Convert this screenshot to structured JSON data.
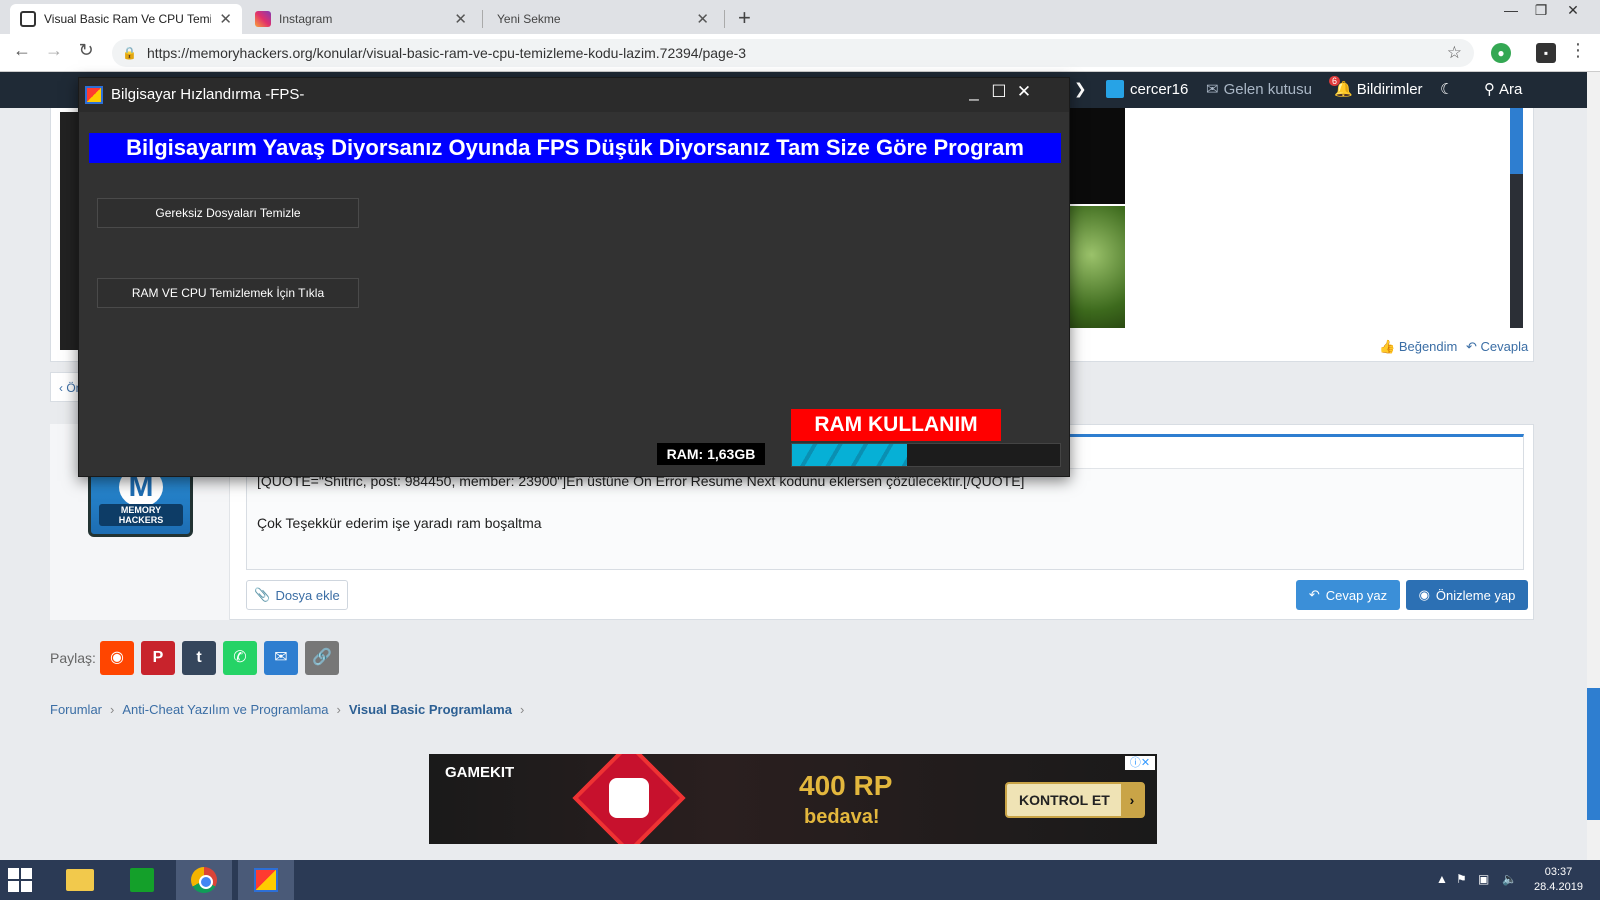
{
  "browser": {
    "tabs": [
      {
        "title": "Visual Basic Ram Ve CPU Temizle"
      },
      {
        "title": "Instagram"
      },
      {
        "title": "Yeni Sekme"
      }
    ],
    "new_tab": "+",
    "url": "https://memoryhackers.org/konular/visual-basic-ram-ve-cpu-temizleme-kodu-lazim.72394/page-3"
  },
  "site_nav": {
    "username": "cercer16",
    "inbox": "Gelen kutusu",
    "alerts": "Bildirimler",
    "alerts_count": "6",
    "search": "Ara"
  },
  "post_actions": {
    "like": "Beğendim",
    "reply": "Cevapla"
  },
  "pager": {
    "prev": "‹ Ön"
  },
  "avatar_text": "MEMORY HACKERS",
  "editor": {
    "line1": "[QUOTE=\"Shitric, post: 984450, member: 23900\"]En üstüne On Error Resume Next kodunu eklersen çözülecektir.[/QUOTE]",
    "line2": "Çok Teşekkür ederim işe yaradı ram boşaltma"
  },
  "buttons": {
    "attach": "Dosya ekle",
    "reply": "Cevap yaz",
    "preview": "Önizleme yap"
  },
  "share": {
    "label": "Paylaş:",
    "items": [
      "reddit",
      "pinterest",
      "tumblr",
      "whatsapp",
      "email",
      "link"
    ]
  },
  "breadcrumbs": [
    "Forumlar",
    "Anti-Cheat Yazılım ve Programlama",
    "Visual Basic Programlama"
  ],
  "ad": {
    "brand": "GAMEKIT",
    "headline": "400 RP",
    "sub": "bedava!",
    "cta": "KONTROL ET"
  },
  "app": {
    "title": "Bilgisayar Hızlandırma -FPS-",
    "banner": "Bilgisayarım Yavaş Diyorsanız Oyunda FPS Düşük Diyorsanız Tam Size Göre Program",
    "btn_clean_files": "Gereksiz Dosyaları Temizle",
    "btn_clean_ram": "RAM VE CPU Temizlemek İçin Tıkla",
    "ram_label": "RAM  KULLANIM",
    "ram_value": "RAM: 1,63GB",
    "ram_progress": 0.43
  },
  "taskbar": {
    "time": "03:37",
    "date": "28.4.2019"
  },
  "colors": {
    "banner": "#0000ff",
    "ram_label": "#ff0000",
    "progress": "#06b0d6",
    "site_nav": "#1f2a36",
    "accent": "#2e7ed0"
  }
}
